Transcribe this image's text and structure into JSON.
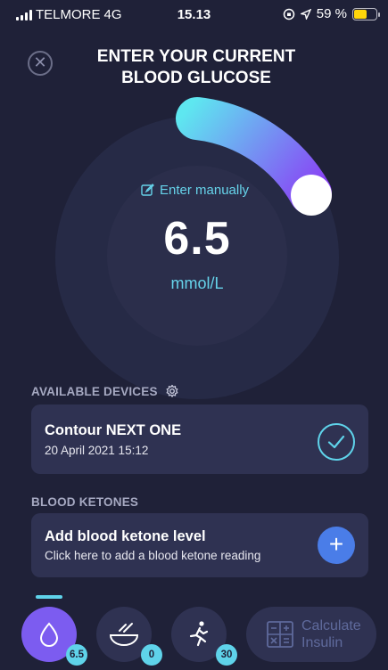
{
  "status_bar": {
    "carrier": "TELMORE",
    "network": "4G",
    "time": "15.13",
    "battery_percent": "59 %",
    "battery_level": 0.59
  },
  "header": {
    "title_line1": "ENTER YOUR CURRENT",
    "title_line2": "BLOOD GLUCOSE"
  },
  "dial": {
    "enter_manually_label": "Enter manually",
    "value": "6.5",
    "unit": "mmol/L",
    "arc_colors": [
      "#5ee7f0",
      "#8a3ff5"
    ]
  },
  "devices": {
    "section_label": "AVAILABLE DEVICES",
    "device_name": "Contour NEXT ONE",
    "device_date": "20 April 2021 15:12"
  },
  "ketones": {
    "section_label": "BLOOD KETONES",
    "card_title": "Add blood ketone level",
    "card_subtitle": "Click here to add a blood ketone reading"
  },
  "bottom_nav": {
    "glucose_badge": "6.5",
    "carbs_badge": "0",
    "exercise_badge": "30",
    "calculate_label_line1": "Calculate",
    "calculate_label_line2": "Insulin"
  }
}
